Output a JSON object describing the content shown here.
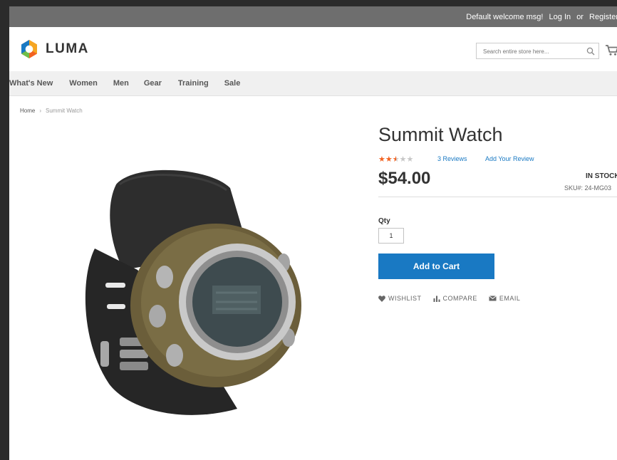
{
  "topbar": {
    "welcome": "Default welcome msg!",
    "login": "Log In",
    "or": "or",
    "register": "Register"
  },
  "header": {
    "logo_text": "LUMA",
    "search_placeholder": "Search entire store here...",
    "icons": [
      "logo-icon",
      "search-icon",
      "cart-icon"
    ]
  },
  "nav": {
    "items": [
      "What's New",
      "Women",
      "Men",
      "Gear",
      "Training",
      "Sale"
    ]
  },
  "breadcrumb": {
    "home": "Home",
    "separator": "›",
    "current": "Summit Watch"
  },
  "product": {
    "name": "Summit Watch",
    "rating": 2.5,
    "rating_max": 5,
    "reviews_link": "3 Reviews",
    "add_review_link": "Add Your Review",
    "price": "$54.00",
    "stock": "IN STOCK",
    "sku_label": "SKU#:",
    "sku_value": "24-MG03",
    "qty_label": "Qty",
    "qty_value": "1",
    "add_to_cart": "Add to Cart",
    "actions": {
      "wishlist": "WISHLIST",
      "compare": "COMPARE",
      "email": "EMAIL"
    }
  },
  "colors": {
    "accent": "#1979c3",
    "star": "#f26322",
    "topbar": "#6e6e6e",
    "nav_bg": "#f0f0f0",
    "logo_orange": "#f26322",
    "logo_blue": "#1979c3"
  }
}
